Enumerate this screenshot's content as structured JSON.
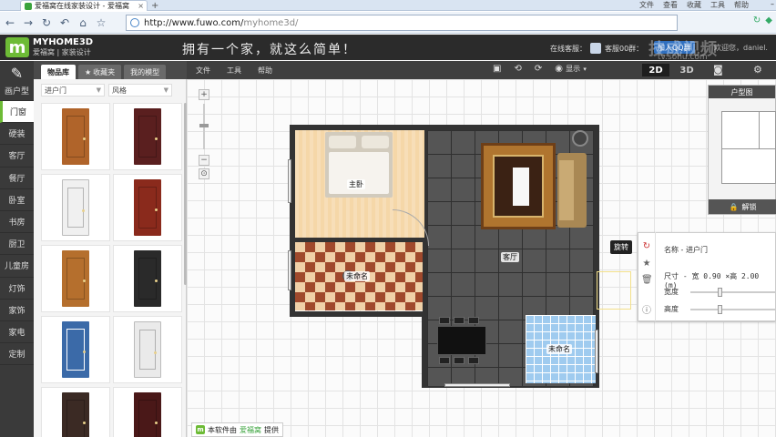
{
  "browser": {
    "tab_title": "爱福窝在线家装设计 - 爱福窝",
    "menu": [
      "文件",
      "查看",
      "收藏",
      "工具",
      "帮助"
    ],
    "url_host": "http://www.fuwo.com/",
    "url_path": "myhome3d/"
  },
  "header": {
    "logo_text": "MYHOME3D",
    "logo_sub": "爱福窝 | 家装设计",
    "slogan": "拥有一个家，就这么简单！",
    "service_label": "在线客服：",
    "service_name": "客服00群：",
    "qq_button": "加入QQ群",
    "welcome": "欢迎您，daniel.",
    "watermark": "技成视频",
    "watermark_url": "tv.sohu.com"
  },
  "leftnav": {
    "top_label": "画户型",
    "items": [
      "门窗",
      "硬装",
      "客厅",
      "餐厅",
      "卧室",
      "书房",
      "厨卫",
      "儿童房",
      "灯饰",
      "家饰",
      "家电",
      "定制"
    ]
  },
  "library": {
    "tabs": [
      "物品库",
      "收藏夹",
      "我的模型"
    ],
    "filter_type": "进户门",
    "filter_style": "风格"
  },
  "toolbar": {
    "menu": [
      "文件",
      "工具",
      "帮助"
    ],
    "display_label": "显示",
    "mode_2d": "2D",
    "mode_3d": "3D"
  },
  "plan": {
    "bedroom_label": "主卧",
    "room2_label": "未命名",
    "living_label": "客厅",
    "bath_label": "未命名"
  },
  "props": {
    "name_row": "名称 - 进户门",
    "size_row": "尺寸 - 宽 0.90 ×高 2.00 (m)",
    "width_label": "宽度",
    "height_label": "高度",
    "rotate_tip": "旋转"
  },
  "mini": {
    "title": "户型图",
    "lock_label": "解锁"
  },
  "footer": {
    "credit_prefix": "本软件由",
    "credit_brand": "爱福窝",
    "credit_suffix": "提供"
  },
  "colors": {
    "brand_green": "#6dbb36",
    "dark_header": "#2b2b2b",
    "qq_blue": "#2f6fbf"
  }
}
